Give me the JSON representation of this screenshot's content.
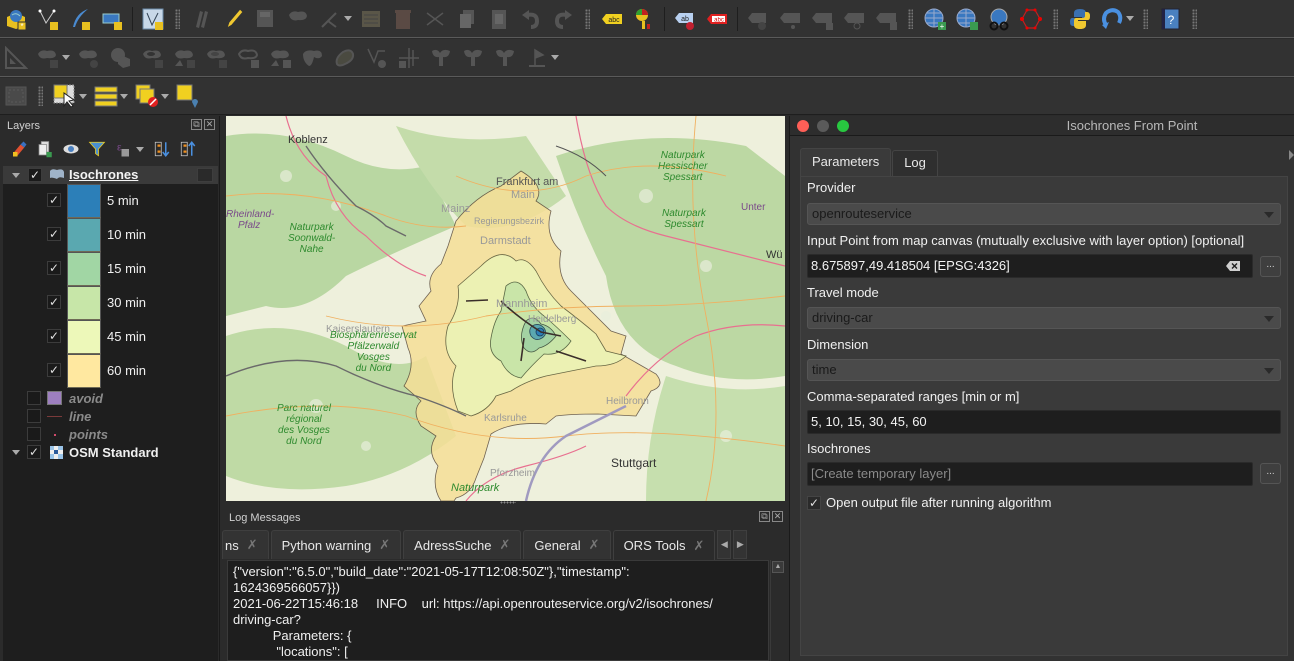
{
  "toolbars": {
    "row1": [
      "data-source-manager-icon",
      "new-shapefile-icon",
      "new-spatialite-icon",
      "new-geopackage-icon",
      "new-virtual-layer-icon",
      "current-edits-icon",
      "toggle-editing-icon",
      "save-edits-icon",
      "add-polygon-icon",
      "vertex-tool-icon",
      "modify-attributes-icon",
      "delete-selected-icon",
      "cut-features-icon",
      "copy-features-icon",
      "paste-features-icon",
      "undo-icon",
      "redo-icon",
      "label-toolbar-icon",
      "diagram-icon",
      "highlight-pinned-label-icon",
      "pin-label-icon",
      "show-hide-labels-icon",
      "move-label-icon",
      "rotate-label-icon",
      "change-label-icon",
      "add-wms-layer-icon",
      "add-wfs-layer-icon",
      "metasearch-icon",
      "shape-digitize-icon",
      "python-console-icon",
      "ors-tools-icon",
      "help-icon"
    ],
    "row2": [
      "advanced-digitizing-icon",
      "move-feature-icon",
      "rotate-feature-icon",
      "simplify-feature-icon",
      "add-ring-icon",
      "add-part-icon",
      "fill-ring-icon",
      "delete-ring-icon",
      "delete-part-icon",
      "reshape-feature-icon",
      "offset-curve-icon",
      "vertex-editor-icon",
      "split-features-icon",
      "split-parts-icon",
      "merge-features-icon",
      "merge-attributes-icon",
      "rotate-point-symbols-icon"
    ],
    "row3": [
      "map-tips-icon",
      "select-features-icon",
      "select-all-icon",
      "deselect-icon",
      "select-by-location-icon"
    ]
  },
  "layers_panel": {
    "title": "Layers",
    "tools": [
      "open-styling-icon",
      "add-group-icon",
      "manage-visibility-icon",
      "filter-legend-icon",
      "filter-expression-icon",
      "expand-all-icon",
      "collapse-all-icon"
    ],
    "layers": [
      {
        "name": "Isochrones",
        "checked": true,
        "expanded": true,
        "legend": [
          {
            "label": "5 min",
            "color": "#2c7fb8",
            "checked": true
          },
          {
            "label": "10 min",
            "color": "#5aa8b0",
            "checked": true
          },
          {
            "label": "15 min",
            "color": "#a1d6a4",
            "checked": true
          },
          {
            "label": "30 min",
            "color": "#c7e6a8",
            "checked": true
          },
          {
            "label": "45 min",
            "color": "#edf8b9",
            "checked": true
          },
          {
            "label": "60 min",
            "color": "#ffe8a0",
            "checked": true
          }
        ]
      },
      {
        "name": "avoid",
        "checked": false,
        "symbol_color": "#9d7fbf"
      },
      {
        "name": "line",
        "checked": false,
        "symbol_color": "#7a3a3a"
      },
      {
        "name": "points",
        "checked": false,
        "symbol_color": "#d04a6a"
      },
      {
        "name": "OSM Standard",
        "checked": true,
        "expanded": true
      }
    ]
  },
  "map": {
    "labels": {
      "koblenz": "Koblenz",
      "frankfurt": "Frankfurt am",
      "main": "Main",
      "mainz": "Mainz",
      "darmstadt": "Darmstadt",
      "regbez": "Regierungsbezirk",
      "rheinland": "Rheinland-",
      "pfalz": "Pfalz",
      "np_soonwald": "Naturpark\nSoonwald-\nNahe",
      "np_hess_spessart": "Naturpark\nHessischer\nSpessart",
      "np_spessart": "Naturpark\nSpessart",
      "biosphere": "Biosphärenreservat\nPfälzerwald\nVosges\ndu Nord",
      "parc_naturel": "Parc naturel\nrégional\ndes Vosges\ndu Nord",
      "mannheim": "Mannheim",
      "heidelberg": "Heidelberg",
      "kaiserslautern": "Kaiserslautern",
      "karlsruhe": "Karlsruhe",
      "heilbronn": "Heilbronn",
      "pforzheim": "Pforzheim",
      "stuttgart": "Stuttgart",
      "np_south": "Naturpark",
      "unter": "Unter",
      "wue": "Wü"
    }
  },
  "log_panel": {
    "title": "Log Messages",
    "tabs": [
      {
        "label": "ns",
        "active": false
      },
      {
        "label": "Python warning",
        "active": false
      },
      {
        "label": "AdressSuche",
        "active": false
      },
      {
        "label": "General",
        "active": false
      },
      {
        "label": "ORS Tools",
        "active": true
      }
    ],
    "lines": [
      "{\"version\":\"6.5.0\",\"build_date\":\"2021-05-17T12:08:50Z\"},\"timestamp\":",
      "1624369566057}})",
      "2021-06-22T15:46:18     INFO    url: https://api.openrouteservice.org/v2/isochrones/",
      "driving-car?",
      "           Parameters: {",
      "            \"locations\": ["
    ]
  },
  "dialog": {
    "title": "Isochrones From Point",
    "tabs": [
      {
        "label": "Parameters",
        "active": true
      },
      {
        "label": "Log",
        "active": false
      }
    ],
    "fields": {
      "provider_label": "Provider",
      "provider_value": "openrouteservice",
      "point_label": "Input Point from map canvas (mutually exclusive with layer option) [optional]",
      "point_value": "8.675897,49.418504 [EPSG:4326]",
      "travel_label": "Travel mode",
      "travel_value": "driving-car",
      "dimension_label": "Dimension",
      "dimension_value": "time",
      "ranges_label": "Comma-separated ranges [min or m]",
      "ranges_value": "5, 10, 15, 30, 45, 60",
      "iso_label": "Isochrones",
      "iso_placeholder": "[Create temporary layer]",
      "open_output_label": "Open output file after running algorithm",
      "open_output_checked": true,
      "browse_label": "..."
    }
  },
  "glyphs": {
    "check": "✓",
    "close": "✕",
    "float": "⧉",
    "tab_close": "✗",
    "left": "◀",
    "right": "▶",
    "up": "▲"
  }
}
